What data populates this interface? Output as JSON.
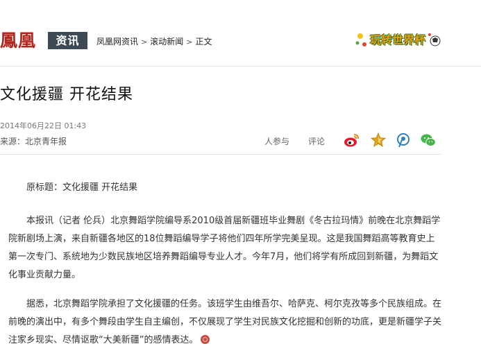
{
  "header": {
    "logo_text": "鳳凰",
    "logo_section": "资讯",
    "breadcrumb": [
      "凤凰网资讯",
      "滚动新闻",
      "正文"
    ],
    "promo_text": "玩转世界杯"
  },
  "article": {
    "title": "文化援疆  开花结果",
    "date": "2014年06月22日 01:43",
    "source_label": "来源：",
    "source_name": "北京青年报",
    "participants_label": "人参与",
    "comment_label": "评论",
    "share_icons": [
      "weibo-icon",
      "star-icon",
      "tencent-weibo-icon",
      "wechat-icon"
    ],
    "paragraphs": [
      "原标题：文化援疆 开花结果",
      "本报讯（记者 伦兵）北京舞蹈学院编导系2010级首届新疆班毕业舞剧《冬古拉玛情》前晚在北京舞蹈学院新剧场上演，来自新疆各地区的18位舞蹈编导学子将他们四年所学完美呈现。这是我国舞蹈高等教育史上第一次专门、系统地为少数民族地区培养舞蹈编导专业人才。今年7月，他们将学有所成回到新疆，为舞蹈文化事业贡献力量。",
      "据悉，北京舞蹈学院承担了文化援疆的任务。该班学生由维吾尔、哈萨克、柯尔克孜等多个民族组成。在前晚的演出中，有多个舞段由学生自主编创，不仅展现了学生对民族文化挖掘和创新的功底，更是新疆学子关注家乡现实、尽情讴歌“大美新疆”的感情表达。"
    ]
  },
  "colors": {
    "brand_red": "#b3261e",
    "section_box": "#3d4a56",
    "weibo_red": "#e6162d",
    "star_gold": "#e0a419",
    "tencent_blue": "#2f7fc1",
    "wechat_green": "#44b549"
  }
}
